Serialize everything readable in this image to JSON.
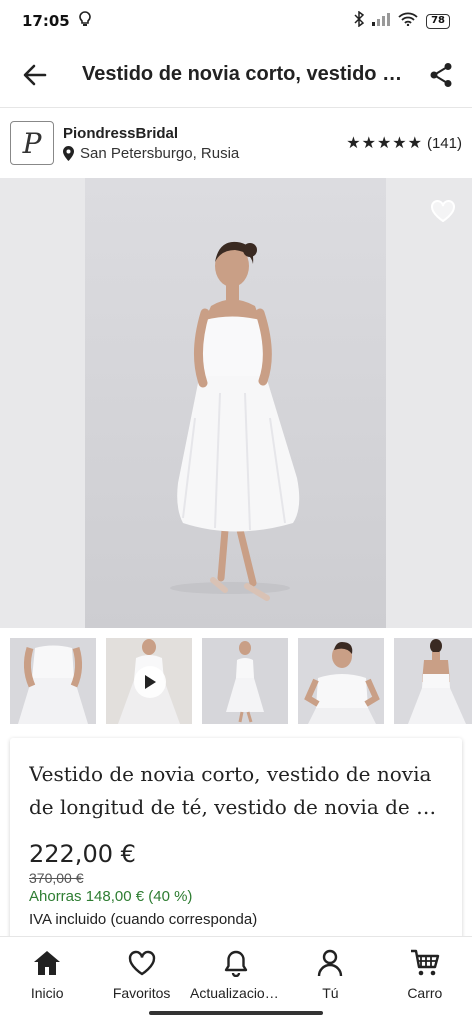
{
  "status_bar": {
    "time": "17:05",
    "battery": "78"
  },
  "app_bar": {
    "title": "Vestido de novia corto, vestido de novia de longitud de té, vestido de novia de n..."
  },
  "shop": {
    "logo_letter": "P",
    "name": "PiondressBridal",
    "location": "San Petersburgo, Rusia",
    "stars": "★★★★★",
    "review_count": "(141)"
  },
  "product": {
    "title_line1": "Vestido de novia corto, vestido de novia",
    "title_line2": "de longitud de té, vestido de novia de n...",
    "price": "222,00 €",
    "old_price": "370,00 €",
    "savings": "Ahorras 148,00 € (40 %)",
    "tax_note": "IVA incluido (cuando corresponda)"
  },
  "thumbnails": [
    {
      "kind": "image"
    },
    {
      "kind": "video"
    },
    {
      "kind": "image"
    },
    {
      "kind": "image"
    },
    {
      "kind": "image"
    }
  ],
  "bottom_nav": {
    "items": [
      {
        "label": "Inicio",
        "icon": "home-icon"
      },
      {
        "label": "Favoritos",
        "icon": "heart-icon"
      },
      {
        "label": "Actualizaciones",
        "icon": "bell-icon"
      },
      {
        "label": "Tú",
        "icon": "user-icon"
      },
      {
        "label": "Carro",
        "icon": "cart-icon"
      }
    ]
  },
  "colors": {
    "savings_green": "#2e7d32",
    "text": "#222222",
    "photo_bg": "#dcdce0"
  }
}
